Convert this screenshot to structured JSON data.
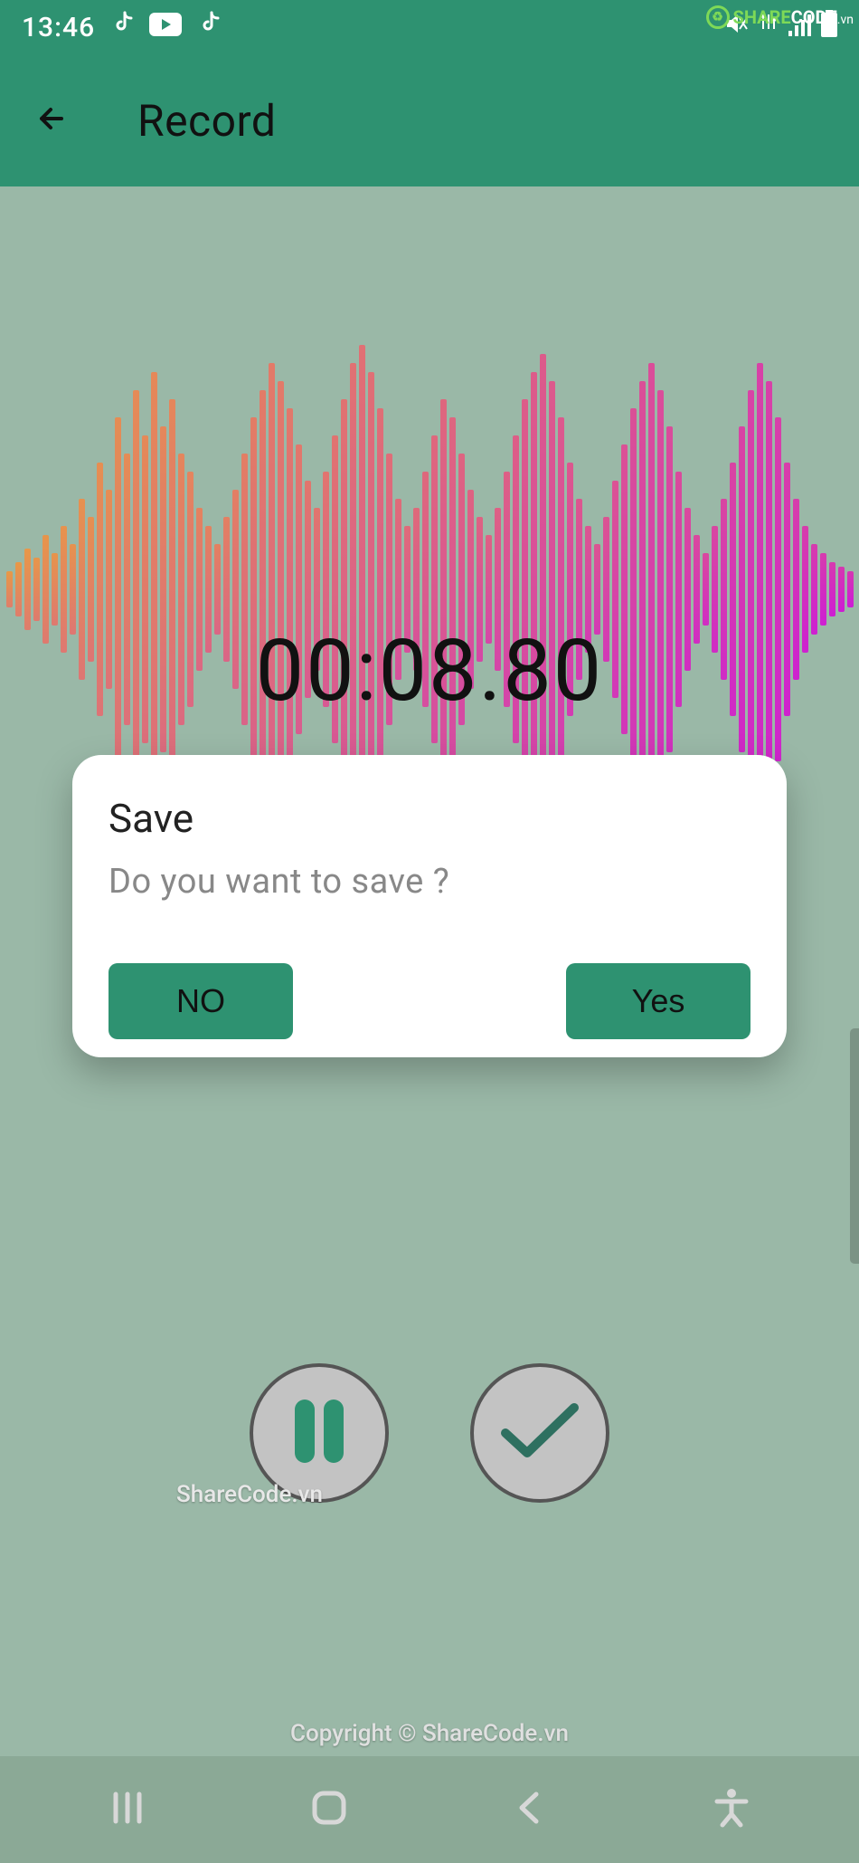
{
  "status": {
    "time": "13:46",
    "icons": [
      "tiktok-icon",
      "youtube-icon",
      "tiktok-icon"
    ],
    "right_icons": [
      "mute-icon",
      "wifi-icon",
      "signal-icon",
      "battery-icon"
    ]
  },
  "appbar": {
    "title": "Record"
  },
  "timer": "00:08.80",
  "dialog": {
    "title": "Save",
    "message": "Do you want to save ?",
    "no_label": "NO",
    "yes_label": "Yes"
  },
  "watermarks": {
    "mid": "ShareCode.vn",
    "bottom": "Copyright © ShareCode.vn",
    "logo_share": "SHARE",
    "logo_code": "CODE",
    "logo_vn": ".vn"
  },
  "colors": {
    "primary": "#2e9271",
    "bg": "#9ab8a7"
  }
}
